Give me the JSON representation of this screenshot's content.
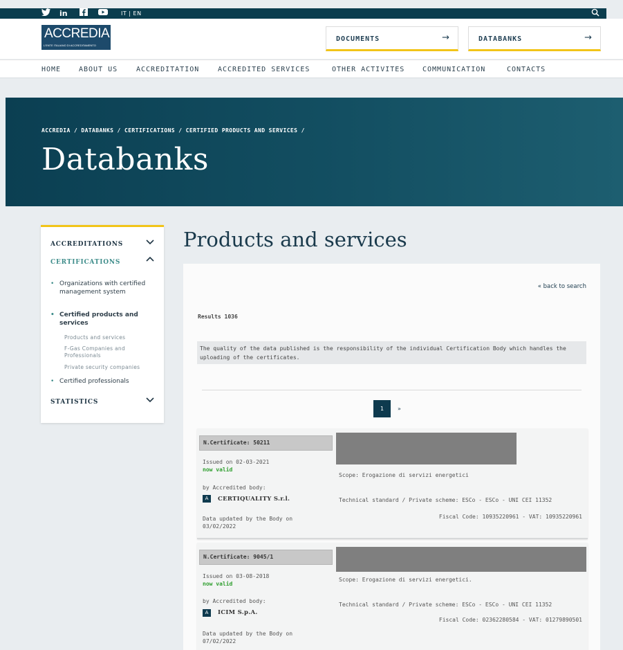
{
  "topbar": {
    "social_icons": [
      "twitter-icon",
      "linkedin-icon",
      "facebook-icon",
      "youtube-icon"
    ],
    "language": "IT | EN",
    "search_icon": "search-icon"
  },
  "header": {
    "logo_text": "ACCREDIA",
    "logo_subtext": "L'ENTE ITALIANO DI ACCREDITAMENTO",
    "buttons": [
      {
        "label": "DOCUMENTS",
        "arrow": "→"
      },
      {
        "label": "DATABANKS",
        "arrow": "→"
      }
    ]
  },
  "nav": [
    "HOME",
    "ABOUT US",
    "ACCREDITATION",
    "ACCREDITED SERVICES",
    "OTHER ACTIVITES",
    "COMMUNICATION",
    "CONTACTS"
  ],
  "hero": {
    "breadcrumb": "ACCREDIA / DATABANKS / CERTIFICATIONS / CERTIFIED PRODUCTS AND SERVICES /",
    "title": "Databanks"
  },
  "sidebar": {
    "accreditations": "ACCREDITATIONS",
    "certifications": "CERTIFICATIONS",
    "items": [
      "Organizations with certified management system",
      "Certified products and services",
      "Certified professionals"
    ],
    "subitems": [
      "Products and services",
      "F-Gas Companies and Professionals",
      "Private security companies"
    ],
    "statistics": "STATISTICS",
    "chevron_down": "⌄",
    "chevron_up": "⌃"
  },
  "main": {
    "title": "Products and services",
    "back_link": "« back to search",
    "results": "Results 1036",
    "notice": "The quality of the data published is the responsibility of the individual Certification Body which handles the uploading of the certificates.",
    "pagination": {
      "current": "1",
      "next": "»"
    }
  },
  "certificates": [
    {
      "number": "N.Certificate: 50211",
      "issued": "Issued on 02-03-2021",
      "status": "now valid",
      "by_label": "by Accredited body:",
      "badge": "A",
      "body_name": "CERTIQUALITY S.r.l.",
      "updated": "Data updated by the Body on 03/02/2022",
      "scope": "Scope: Erogazione di servizi energetici",
      "standard": "Technical standard / Private scheme: ESCo - ESCo - UNI CEI 11352",
      "fiscal": "Fiscal Code: 10935220961 - VAT: 10935220961"
    },
    {
      "number": "N.Certificate: 9045/1",
      "issued": "Issued on 03-08-2018",
      "status": "now valid",
      "by_label": "by Accredited body:",
      "badge": "A",
      "body_name": "ICIM S.p.A.",
      "updated": "Data updated by the Body on 07/02/2022",
      "scope": "Scope: Erogazione di servizi energetici.",
      "standard": "Technical standard / Private scheme: ESCo - ESCo - UNI CEI 11352",
      "fiscal": "Fiscal Code: 02362280584 - VAT: 01279890501"
    }
  ]
}
